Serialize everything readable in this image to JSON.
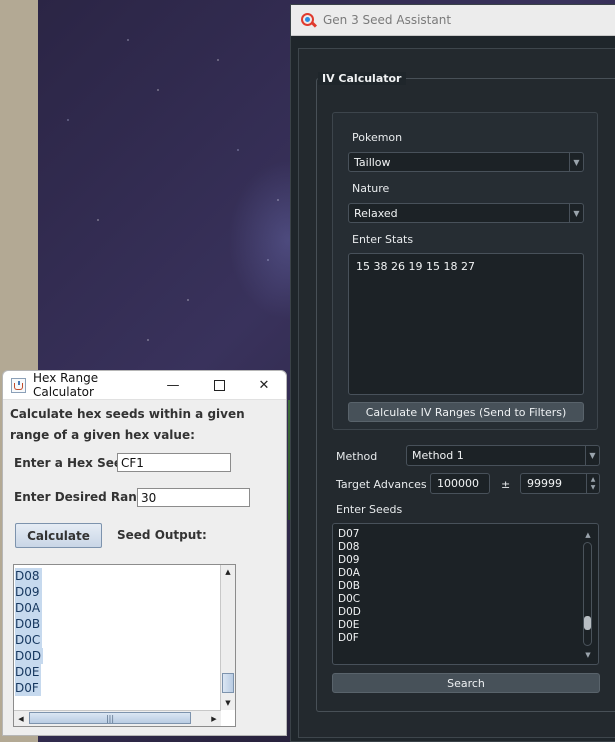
{
  "gen3": {
    "title": "Gen 3 Seed Assistant",
    "group_title": "IV Calculator",
    "pokemon_label": "Pokemon",
    "pokemon_value": "Taillow",
    "nature_label": "Nature",
    "nature_value": "Relaxed",
    "stats_label": "Enter Stats",
    "stats_value": "15 38 26 19 15 18 27",
    "calc_button": "Calculate IV Ranges (Send to Filters)",
    "method_label": "Method",
    "method_value": "Method 1",
    "target_label": "Target Advances",
    "target_value": "100000",
    "plusminus": "±",
    "range_value": "99999",
    "seeds_label": "Enter Seeds",
    "seeds": [
      "D07",
      "D08",
      "D09",
      "D0A",
      "D0B",
      "D0C",
      "D0D",
      "D0E",
      "D0F"
    ],
    "search_button": "Search"
  },
  "hex": {
    "title": "Hex Range Calculator",
    "desc_line1": "Calculate hex seeds within a given",
    "desc_line2": "range of a given hex value:",
    "hex_label": "Enter a Hex Seed:",
    "hex_value": "CF1",
    "range_label": "Enter Desired Range:",
    "range_value": "30",
    "calc_button": "Calculate",
    "output_label": "Seed Output:",
    "output": [
      "D08",
      "D09",
      "D0A",
      "D0B",
      "D0C",
      "D0D",
      "D0E",
      "D0F"
    ]
  },
  "colors": {
    "dark_bg": "#1f262b",
    "accent_icon": "#e03b2e",
    "selection": "#c6d9ee"
  }
}
